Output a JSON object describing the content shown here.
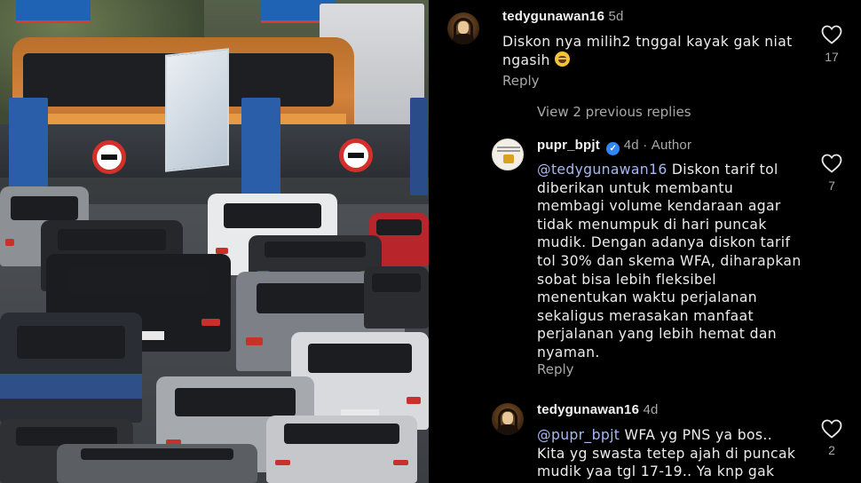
{
  "photo": {
    "alt_subject": ""
  },
  "comments": [
    {
      "username": "tedygunawan16",
      "age": "5d",
      "text": "Diskon nya milih2 tnggal kayak gak niat ngasih",
      "emoji": "grinning-sweat-emoji",
      "reply_label": "Reply",
      "likes": "17"
    },
    {
      "view_replies_label": "View 2 previous replies"
    },
    {
      "username": "pupr_bpjt",
      "age": "4d",
      "author_label": "Author",
      "mention": "@tedygunawan16",
      "text": "Diskon tarif tol diberikan untuk membantu membagi volume kendaraan agar tidak menumpuk di hari puncak mudik. Dengan adanya diskon tarif tol 30% dan skema WFA, diharapkan sobat bisa lebih fleksibel menentukan waktu perjalanan sekaligus merasakan manfaat perjalanan yang lebih hemat dan nyaman.",
      "reply_label": "Reply",
      "likes": "7"
    },
    {
      "username": "tedygunawan16",
      "age": "4d",
      "mention": "@pupr_bpjt",
      "text": "WFA yg PNS ya bos.. Kita yg swasta tetep ajah di puncak mudik yaa tgl 17-19.. Ya knp gak",
      "likes": "2"
    }
  ],
  "colors": {
    "background": "#000000",
    "mention": "#a7b8f5",
    "muted": "#a8a8a8",
    "verified": "#2f86f6"
  },
  "icons": {
    "like": "heart-icon",
    "verified": "verified-badge-icon"
  }
}
